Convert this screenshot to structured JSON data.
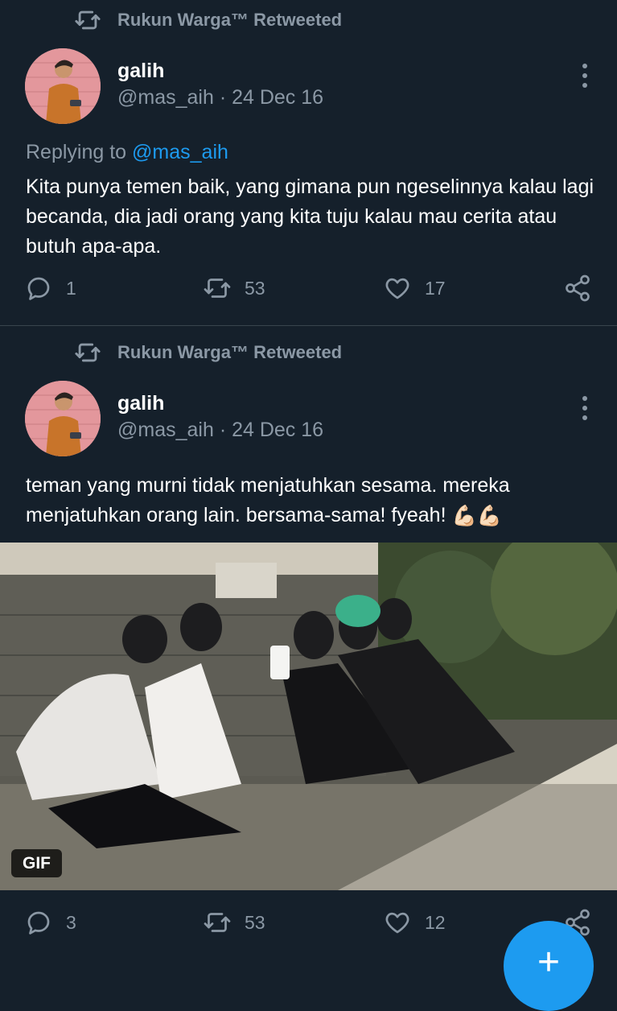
{
  "colors": {
    "background": "#15202b",
    "secondary_text": "#8b98a5",
    "link": "#1d9bf0",
    "divider": "#38444d"
  },
  "tweets": [
    {
      "retweet_label": "Rukun Warga™ Retweeted",
      "author_name": "galih",
      "author_meta": "@mas_aih · 24 Dec 16",
      "replying_prefix": "Replying to",
      "replying_handle": "@mas_aih",
      "text": "Kita punya temen baik, yang gimana pun ngeselinnya kalau lagi becanda, dia jadi orang yang kita tuju kalau mau cerita atau butuh apa-apa.",
      "reply_count": "1",
      "retweet_count": "53",
      "like_count": "17",
      "icons": [
        "retweet-icon",
        "reply-icon",
        "like-icon",
        "share-icon",
        "more-icon"
      ]
    },
    {
      "retweet_label": "Rukun Warga™ Retweeted",
      "author_name": "galih",
      "author_meta": "@mas_aih · 24 Dec 16",
      "text": "teman yang murni tidak menjatuhkan sesama. mereka menjatuhkan orang lain. bersama-sama! fyeah!",
      "emoji": "💪🏻💪🏻",
      "media_badge": "GIF",
      "reply_count": "3",
      "retweet_count": "53",
      "like_count": "12",
      "icons": [
        "retweet-icon",
        "reply-icon",
        "like-icon",
        "share-icon",
        "more-icon"
      ]
    }
  ],
  "fab": {
    "label": "+",
    "icon": "compose-plus-icon"
  }
}
